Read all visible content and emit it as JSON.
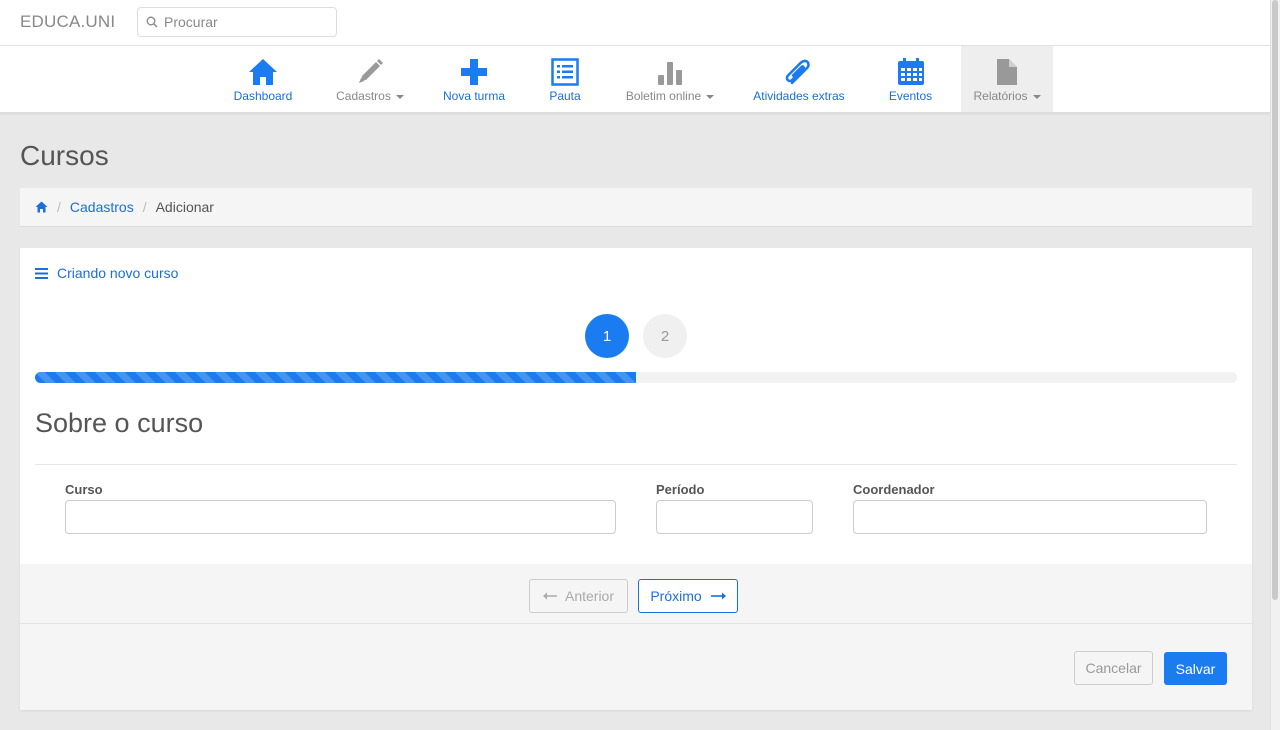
{
  "app": {
    "brand": "EDUCA.UNI"
  },
  "search": {
    "placeholder": "Procurar"
  },
  "nav": {
    "items": [
      {
        "label": "Dashboard",
        "icon": "home-icon",
        "color": "#1a6fd9"
      },
      {
        "label": "Cadastros",
        "icon": "pencil-icon",
        "color": "#888888",
        "dropdown": true
      },
      {
        "label": "Nova turma",
        "icon": "plus-icon",
        "color": "#1a6fd9"
      },
      {
        "label": "Pauta",
        "icon": "list-icon",
        "color": "#1a6fd9"
      },
      {
        "label": "Boletim online",
        "icon": "bar-chart-icon",
        "color": "#888888",
        "dropdown": true
      },
      {
        "label": "Atividades extras",
        "icon": "paperclip-icon",
        "color": "#1a6fd9"
      },
      {
        "label": "Eventos",
        "icon": "calendar-icon",
        "color": "#1a6fd9"
      },
      {
        "label": "Relatórios",
        "icon": "file-icon",
        "color": "#888888",
        "dropdown": true,
        "active": true
      }
    ]
  },
  "page": {
    "title": "Cursos"
  },
  "breadcrumb": {
    "home_icon": "home-icon",
    "items": [
      "Cadastros",
      "Adicionar"
    ]
  },
  "panel": {
    "heading": "Criando novo curso",
    "heading_icon": "bars-icon",
    "steps": [
      "1",
      "2"
    ],
    "current_step": 1,
    "progress_percent": 50,
    "section_title": "Sobre o curso",
    "fields": [
      {
        "label": "Curso",
        "value": ""
      },
      {
        "label": "Período",
        "value": ""
      },
      {
        "label": "Coordenador",
        "value": ""
      }
    ],
    "wizard": {
      "prev_label": "Anterior",
      "next_label": "Próximo"
    },
    "actions": {
      "cancel_label": "Cancelar",
      "save_label": "Salvar"
    }
  },
  "colors": {
    "accent": "#1a7cf0",
    "link": "#1a6fd9",
    "muted": "#888888"
  }
}
